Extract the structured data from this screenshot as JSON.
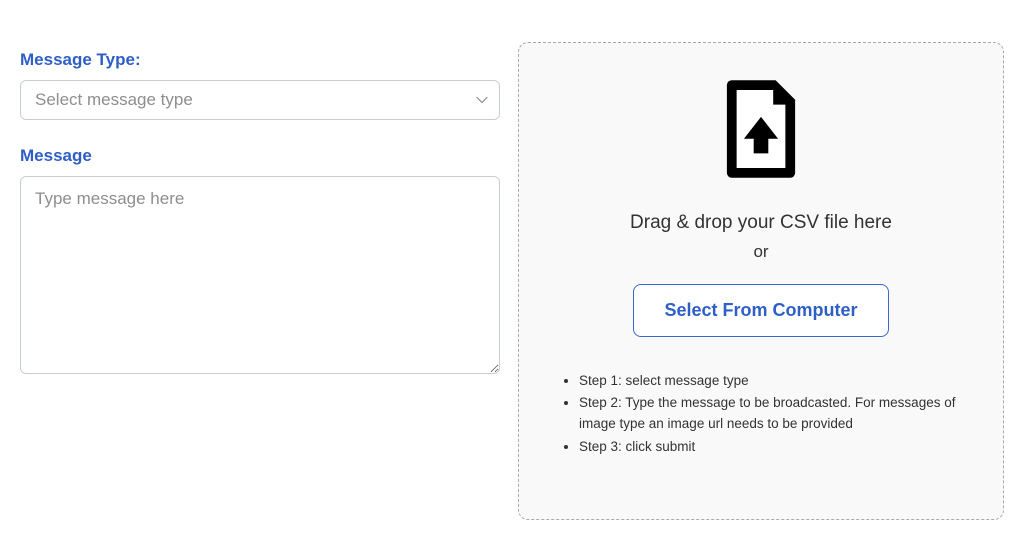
{
  "form": {
    "message_type_label": "Message Type:",
    "message_type_placeholder": "Select message type",
    "message_label": "Message",
    "message_placeholder": "Type message here"
  },
  "dropzone": {
    "drag_text": "Drag & drop your CSV file here",
    "or_text": "or",
    "select_button": "Select From Computer"
  },
  "steps": [
    "Step 1: select message type",
    "Step 2: Type the message to be broadcasted. For messages of image type an image url needs to be provided",
    "Step 3: click submit"
  ]
}
